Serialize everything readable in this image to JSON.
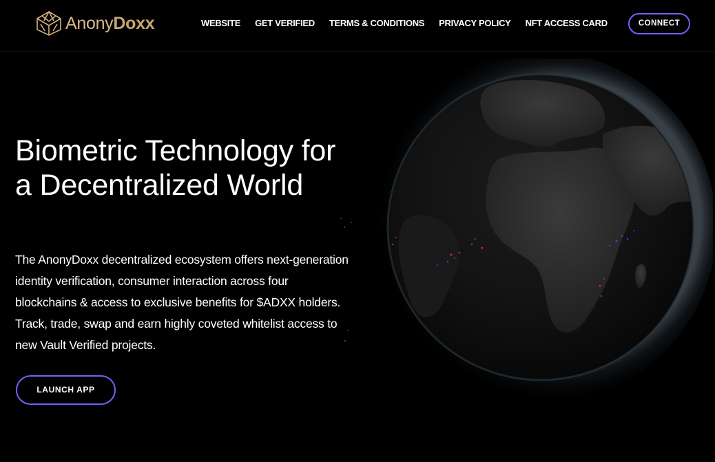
{
  "header": {
    "logo": {
      "icon": "anonydoxx-logo-mark",
      "text_light": "Anony",
      "text_bold": "Doxx"
    },
    "nav": [
      {
        "label": "WEBSITE"
      },
      {
        "label": "GET VERIFIED"
      },
      {
        "label": "TERMS & CONDITIONS"
      },
      {
        "label": "PRIVACY POLICY"
      },
      {
        "label": "NFT ACCESS CARD"
      }
    ],
    "connect_label": "CONNECT"
  },
  "hero": {
    "title": "Biometric Technology for a Decentralized World",
    "description": "The AnonyDoxx decentralized ecosystem offers next-generation identity verification, consumer interaction across four blockchains & access to exclusive benefits for $ADXX holders. Track, trade, swap and earn highly coveted whitelist access to new Vault Verified projects.",
    "launch_label": "LAUNCH APP",
    "visual": "globe-image"
  },
  "colors": {
    "background": "#000000",
    "accent_border": "#7b5cff",
    "logo_gold": "#c9a473",
    "text": "#ffffff"
  }
}
